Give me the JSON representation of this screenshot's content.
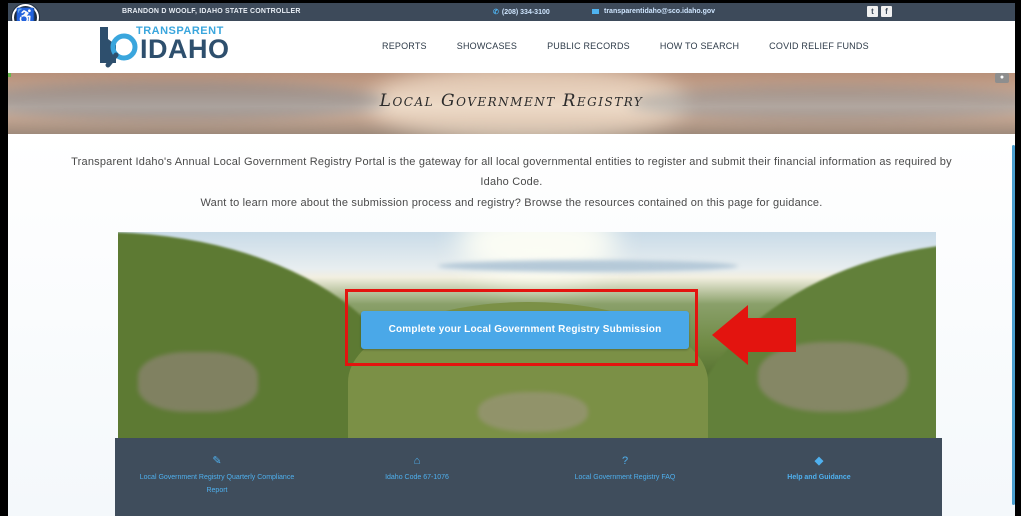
{
  "topbar": {
    "controller": "BRANDON D WOOLF, IDAHO STATE CONTROLLER",
    "phone": "(208) 334-3100",
    "email": "transparentidaho@sco.idaho.gov",
    "social_icons": [
      "twitter-icon",
      "facebook-icon"
    ]
  },
  "logo": {
    "line1": "TRANSPARENT",
    "line2": "IDAHO"
  },
  "nav": {
    "items": [
      "REPORTS",
      "SHOWCASES",
      "PUBLIC RECORDS",
      "HOW TO SEARCH",
      "COVID RELIEF FUNDS"
    ]
  },
  "banner": {
    "title": "Local Government Registry"
  },
  "intro": {
    "paragraph1": "Transparent Idaho's Annual Local Government Registry Portal is the gateway for all local governmental entities to register and submit their financial information as required by Idaho Code.",
    "paragraph2": "Want to learn more about the submission process and registry? Browse the resources contained on this page for guidance."
  },
  "cta": {
    "label": "Complete your Local Government Registry Submission"
  },
  "footer_links": [
    {
      "icon": "document-edit-icon",
      "label": "Local Government Registry Quarterly Compliance Report"
    },
    {
      "icon": "building-icon",
      "label": "Idaho Code 67-1076"
    },
    {
      "icon": "question-icon",
      "label": "Local Government Registry FAQ"
    },
    {
      "icon": "megaphone-icon",
      "label": "Help and Guidance"
    }
  ],
  "colors": {
    "topbar": "#3d4a5a",
    "accent": "#4aa8e8",
    "highlight": "#e3140f",
    "footer": "#3f4d5c"
  }
}
